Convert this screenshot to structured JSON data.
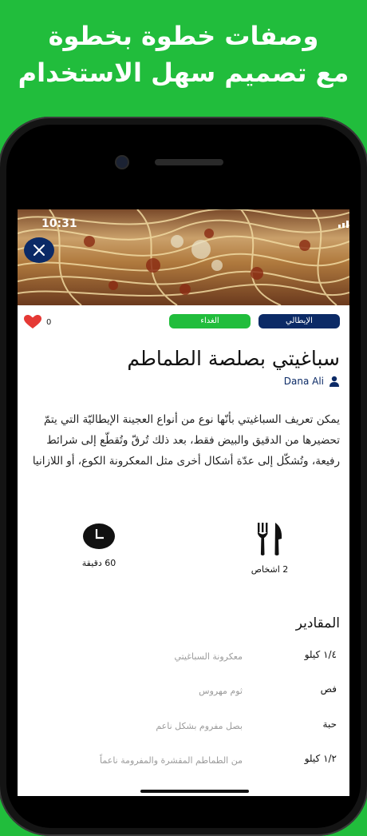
{
  "promo": {
    "line1": "وصفات خطوة بخطوة",
    "line2": "مع تصميم سهل الاستخدام"
  },
  "status_bar": {
    "time": "10:31"
  },
  "recipe": {
    "likes": "0",
    "cuisine_tag": "الإيطالي",
    "meal_tag": "الغداء",
    "title": "سباغيتي بصلصة الطماطم",
    "author": "Dana Ali",
    "description": "يمكن تعريف السباغيتي بأنّها نوع من أنواع العجينة الإيطاليّة التي يتمّ تحضيرها من الدقيق والبيض فقط، بعد ذلك تُرقّ وتُقطّع إلى شرائط رفيعة، وتُشكّل إلى عدّة أشكال أخرى مثل المعكرونة الكوع، أو اللازانيا",
    "servings": "2 اشخاص",
    "cook_time": "60 دقيقة"
  },
  "ingredients": {
    "title": "المقادير",
    "items": [
      {
        "qty": "١/٤ كيلو",
        "name": "معكرونة السباغيتي"
      },
      {
        "qty": "فص",
        "name": "ثوم مهروس"
      },
      {
        "qty": "حبة",
        "name": "بصل مفروم بشكل ناعم"
      },
      {
        "qty": "١/٢ كيلو",
        "name": "من الطماطم المقشرة والمفرومة ناعماً"
      }
    ]
  },
  "icons": {
    "close": "close-icon",
    "heart": "heart-icon",
    "person": "person-icon",
    "cutlery": "fork-knife-icon",
    "clock": "clock-icon"
  },
  "colors": {
    "brand_green": "#21bd3c",
    "navy": "#0b2a66",
    "heart_red": "#e53935"
  }
}
